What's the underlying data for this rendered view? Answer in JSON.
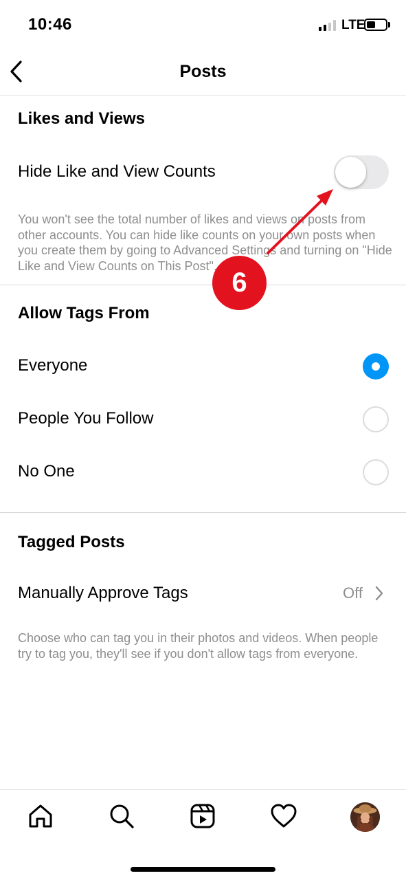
{
  "status_bar": {
    "time": "10:46",
    "network": "LTE"
  },
  "header": {
    "title": "Posts"
  },
  "likes_and_views": {
    "section_title": "Likes and Views",
    "toggle_label": "Hide Like and View Counts",
    "toggle_on": false,
    "description": "You won't see the total number of likes and views on posts from other accounts. You can hide like counts on your own posts when you create them by going to Advanced Settings and turning on \"Hide Like and View Counts on This Post\"."
  },
  "allow_tags_from": {
    "section_title": "Allow Tags From",
    "options": [
      {
        "label": "Everyone",
        "selected": true
      },
      {
        "label": "People You Follow",
        "selected": false
      },
      {
        "label": "No One",
        "selected": false
      }
    ]
  },
  "tagged_posts": {
    "section_title": "Tagged Posts",
    "row_label": "Manually Approve Tags",
    "row_value": "Off",
    "description": "Choose who can tag you in their photos and videos. When people try to tag you, they'll see if you don't allow tags from everyone."
  },
  "annotation": {
    "step_number": "6",
    "color": "#e3121f"
  },
  "tab_bar": {
    "items": [
      {
        "icon": "home-icon"
      },
      {
        "icon": "search-icon"
      },
      {
        "icon": "reels-icon"
      },
      {
        "icon": "heart-icon"
      },
      {
        "icon": "profile-avatar"
      }
    ]
  },
  "colors": {
    "accent": "#0095f6",
    "secondary_text": "#8e8e8e",
    "toggle_off": "#e9e9eb"
  }
}
